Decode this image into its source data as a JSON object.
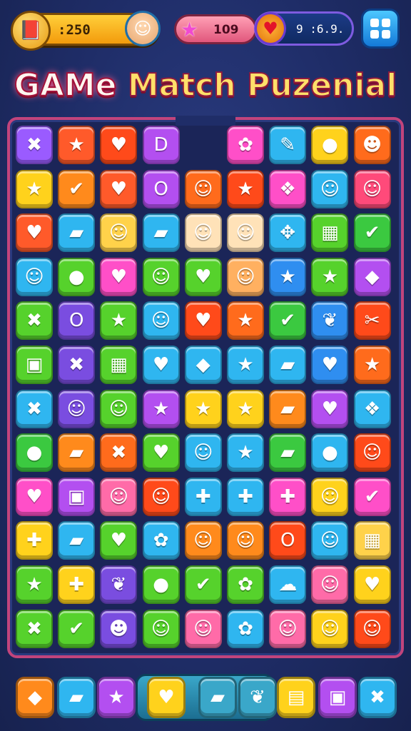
{
  "hud": {
    "coins": ":250",
    "stars": "109",
    "lives": "9 :6.9.",
    "coin_icon": "chest-icon",
    "avatar_icon": "player-avatar",
    "star_icon": "star-icon",
    "heart_icon": "heart-icon",
    "menu_icon": "grid-menu-icon"
  },
  "title": {
    "part1": "GAMe",
    "part2": "Match Puzenial"
  },
  "board": {
    "columns": 9,
    "rows": 11,
    "tiles": [
      [
        "#9a5bff",
        "✖"
      ],
      [
        "#ff5a2a",
        "★"
      ],
      [
        "#ff4a1a",
        "♥"
      ],
      [
        "#b34ff0",
        "D"
      ],
      [
        "",
        ""
      ],
      [
        "#ff4fc8",
        "✿"
      ],
      [
        "#2fb6f0",
        "✎"
      ],
      [
        "#ffd21c",
        "●"
      ],
      [
        "#ff6b1c",
        "☻"
      ],
      [
        "#ffd21c",
        "★"
      ],
      [
        "#ff8a1c",
        "✔"
      ],
      [
        "#ff5a2a",
        "♥"
      ],
      [
        "#b34ff0",
        "O"
      ],
      [
        "#ff6b1c",
        "☺"
      ],
      [
        "#ff4a1a",
        "★"
      ],
      [
        "#ff4fc8",
        "❖"
      ],
      [
        "#2fb6f0",
        "☺"
      ],
      [
        "#ff4a7a",
        "☺"
      ],
      [
        "#ff5a2a",
        "♥"
      ],
      [
        "#2fb6f0",
        "▰"
      ],
      [
        "#ffd24a",
        "☺"
      ],
      [
        "#2fb6f0",
        "▰"
      ],
      [
        "#ffe2b8",
        "☺"
      ],
      [
        "#ffe2b8",
        "☺"
      ],
      [
        "#2fb6f0",
        "✥"
      ],
      [
        "#56d22c",
        "▦"
      ],
      [
        "#3bc940",
        "✔"
      ],
      [
        "#2fb6f0",
        "☺"
      ],
      [
        "#56d22c",
        "●"
      ],
      [
        "#ff4fc8",
        "♥"
      ],
      [
        "#56d22c",
        "☺"
      ],
      [
        "#56d22c",
        "♥"
      ],
      [
        "#ffb060",
        "☺"
      ],
      [
        "#2f8ef0",
        "★"
      ],
      [
        "#56d22c",
        "★"
      ],
      [
        "#b34ff0",
        "◆"
      ],
      [
        "#56d22c",
        "✖"
      ],
      [
        "#7a4de0",
        "O"
      ],
      [
        "#56d22c",
        "★"
      ],
      [
        "#2fb6f0",
        "☺"
      ],
      [
        "#ff4a1a",
        "♥"
      ],
      [
        "#ff6b1c",
        "★"
      ],
      [
        "#3bc940",
        "✔"
      ],
      [
        "#2f8ef0",
        "❦"
      ],
      [
        "#ff4a1a",
        "✂"
      ],
      [
        "#56d22c",
        "▣"
      ],
      [
        "#7a4de0",
        "✖"
      ],
      [
        "#56d22c",
        "▦"
      ],
      [
        "#2fb6f0",
        "♥"
      ],
      [
        "#2fb6f0",
        "◆"
      ],
      [
        "#2fb6f0",
        "★"
      ],
      [
        "#2fb6f0",
        "▰"
      ],
      [
        "#2f8ef0",
        "♥"
      ],
      [
        "#ff6b1c",
        "★"
      ],
      [
        "#2fb6f0",
        "✖"
      ],
      [
        "#7a4de0",
        "☺"
      ],
      [
        "#56d22c",
        "☺"
      ],
      [
        "#b34ff0",
        "★"
      ],
      [
        "#ffd21c",
        "★"
      ],
      [
        "#ffd21c",
        "★"
      ],
      [
        "#ff8a1c",
        "▰"
      ],
      [
        "#b34ff0",
        "♥"
      ],
      [
        "#2fb6f0",
        "❖"
      ],
      [
        "#3bc940",
        "●"
      ],
      [
        "#ff8a1c",
        "▰"
      ],
      [
        "#ff6b1c",
        "✖"
      ],
      [
        "#56d22c",
        "♥"
      ],
      [
        "#2fb6f0",
        "☺"
      ],
      [
        "#2fb6f0",
        "★"
      ],
      [
        "#3bc940",
        "▰"
      ],
      [
        "#2fb6f0",
        "●"
      ],
      [
        "#ff4a1a",
        "☺"
      ],
      [
        "#ff4fc8",
        "♥"
      ],
      [
        "#b34ff0",
        "▣"
      ],
      [
        "#ff6ba8",
        "☺"
      ],
      [
        "#ff4a1a",
        "☺"
      ],
      [
        "#2fb6f0",
        "✚"
      ],
      [
        "#2fb6f0",
        "✚"
      ],
      [
        "#ff4fc8",
        "✚"
      ],
      [
        "#ffd21c",
        "☺"
      ],
      [
        "#ff4fc8",
        "✔"
      ],
      [
        "#ffd21c",
        "✚"
      ],
      [
        "#2fb6f0",
        "▰"
      ],
      [
        "#56d22c",
        "♥"
      ],
      [
        "#2fb6f0",
        "✿"
      ],
      [
        "#ff8a1c",
        "☺"
      ],
      [
        "#ff8a1c",
        "☺"
      ],
      [
        "#ff4a1a",
        "O"
      ],
      [
        "#2fb6f0",
        "☺"
      ],
      [
        "#ffd24a",
        "▦"
      ],
      [
        "#56d22c",
        "★"
      ],
      [
        "#ffd21c",
        "✚"
      ],
      [
        "#7a4de0",
        "❦"
      ],
      [
        "#56d22c",
        "●"
      ],
      [
        "#56d22c",
        "✔"
      ],
      [
        "#56d22c",
        "✿"
      ],
      [
        "#2fb6f0",
        "☁"
      ],
      [
        "#ff6ba8",
        "☺"
      ],
      [
        "#ffd21c",
        "♥"
      ],
      [
        "#56d22c",
        "✖"
      ],
      [
        "#56d22c",
        "✔"
      ],
      [
        "#7a4de0",
        "☻"
      ],
      [
        "#56d22c",
        "☺"
      ],
      [
        "#ff6ba8",
        "☺"
      ],
      [
        "#2fb6f0",
        "✿"
      ],
      [
        "#ff6ba8",
        "☺"
      ],
      [
        "#ffd21c",
        "☺"
      ],
      [
        "#ff4a1a",
        "☺"
      ]
    ]
  },
  "booster_bar": {
    "items": [
      {
        "icon": "eraser-icon",
        "glyph": "◆",
        "color": "#ff8a1c"
      },
      {
        "icon": "brush-icon",
        "glyph": "▰",
        "color": "#2fb6f0"
      },
      {
        "icon": "star-icon",
        "glyph": "★",
        "color": "#b34ff0"
      },
      {
        "icon": "fire-icon",
        "glyph": "♥",
        "color": "#ffd21c"
      },
      {
        "icon": "wand-icon",
        "glyph": "▰",
        "color": "#3aa7c9"
      },
      {
        "icon": "salad-bowl-icon",
        "glyph": "❦",
        "color": "#3aa7c9"
      },
      {
        "icon": "scroll-icon",
        "glyph": "▤",
        "color": "#ffd21c"
      },
      {
        "icon": "robot-icon",
        "glyph": "▣",
        "color": "#b34ff0"
      },
      {
        "icon": "cross-icon",
        "glyph": "✖",
        "color": "#2fb6f0"
      }
    ]
  }
}
